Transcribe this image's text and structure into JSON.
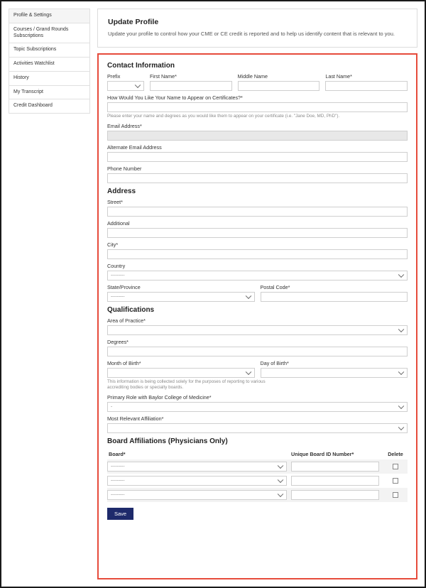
{
  "sidebar": {
    "items": [
      "Profile & Settings",
      "Courses / Grand Rounds Subscriptions",
      "Topic Subscriptions",
      "Activities Watchlist",
      "History",
      "My Transcript",
      "Credit Dashboard"
    ]
  },
  "header": {
    "title": "Update Profile",
    "desc": "Update your profile to control how your CME or CE credit is reported and to help us identify content that is relevant to you."
  },
  "contact": {
    "title": "Contact Information",
    "prefix": "Prefix",
    "first": "First Name*",
    "middle": "Middle Name",
    "last": "Last Name*",
    "cert_label": "How Would You Like Your Name to Appear on Certificates?*",
    "cert_hint": "Please enter your name and degrees as you would like them to appear on your certificate (i.e. \"Jane Doe, MD, PhD\").",
    "email": "Email Address*",
    "alt_email": "Alternate Email Address",
    "phone": "Phone Number"
  },
  "address": {
    "title": "Address",
    "street": "Street*",
    "additional": "Additional",
    "city": "City*",
    "country": "Country",
    "state": "State/Province",
    "postal": "Postal Code*",
    "dashes": "---------"
  },
  "qual": {
    "title": "Qualifications",
    "area": "Area of Practice*",
    "degrees": "Degrees*",
    "mob": "Month of Birth*",
    "dob": "Day of Birth*",
    "note": "This information is being collected solely for the purposes of reporting to various accrediting bodies or specialty boards.",
    "role": "Primary Role with Baylor College of Medicine*",
    "role_val": "-",
    "affil": "Most Relevant Affiliation*"
  },
  "boards": {
    "title": "Board Affiliations (Physicians Only)",
    "col_board": "Board*",
    "col_id": "Unique Board ID Number*",
    "col_delete": "Delete",
    "dashes": "---------"
  },
  "save": "Save"
}
